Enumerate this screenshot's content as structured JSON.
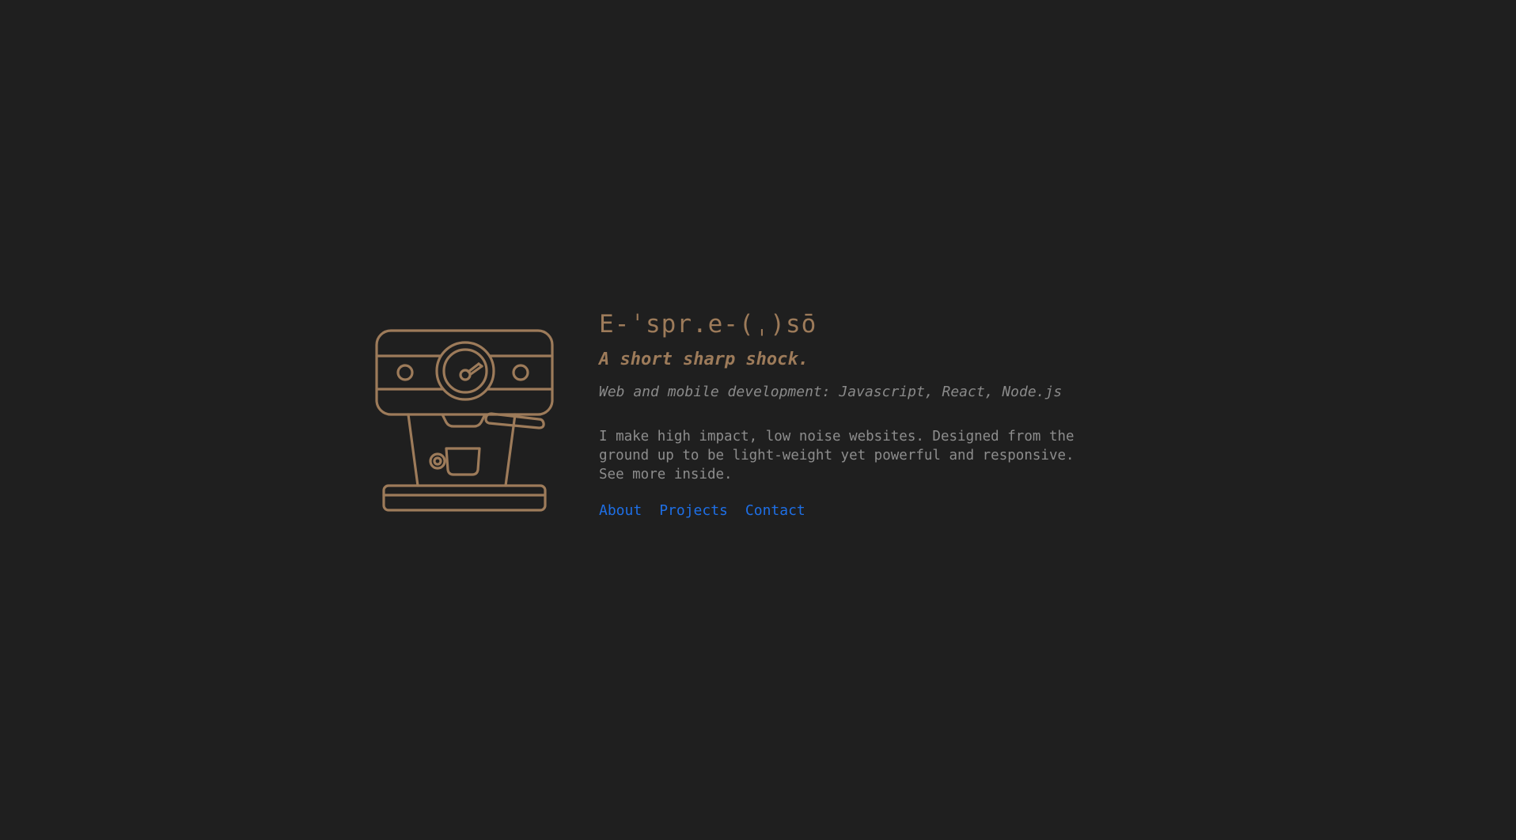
{
  "header": {
    "title": "E-ˈspr.e-(ˌ)sō",
    "tagline": "A short sharp shock.",
    "subtitle": "Web and mobile development: Javascript, React, Node.js"
  },
  "intro": {
    "description": "I make high impact, low noise websites. Designed from the ground up to be light-weight yet powerful and responsive. See more inside."
  },
  "nav": {
    "links": [
      {
        "label": "About"
      },
      {
        "label": "Projects"
      },
      {
        "label": "Contact"
      }
    ]
  },
  "colors": {
    "background": "#1f1f1f",
    "accent": "#9d7b5a",
    "text": "#8d8d8d",
    "link": "#1e6fe6"
  },
  "icons": {
    "logo": "espresso-machine-icon"
  }
}
